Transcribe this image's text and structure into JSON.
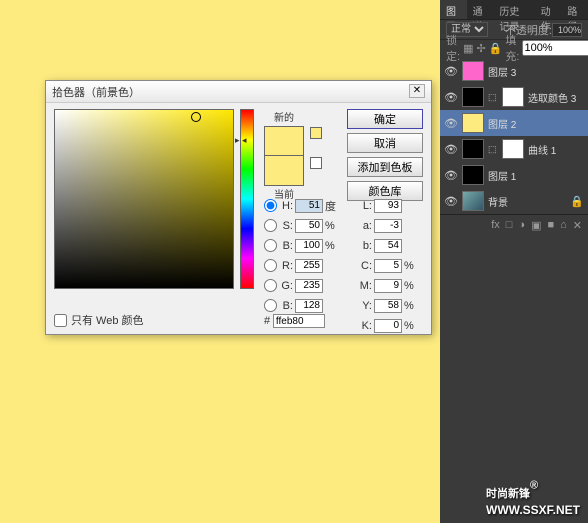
{
  "canvas": {
    "bg": "#fdeb80"
  },
  "dialog": {
    "title": "拾色器（前景色）",
    "close": "✕",
    "new_label": "新的",
    "current_label": "当前",
    "buttons": {
      "ok": "确定",
      "cancel": "取消",
      "add": "添加到色板",
      "lib": "颜色库"
    },
    "hsb": {
      "h": {
        "lbl": "H:",
        "val": "51",
        "unit": "度"
      },
      "s": {
        "lbl": "S:",
        "val": "50",
        "unit": "%"
      },
      "b": {
        "lbl": "B:",
        "val": "100",
        "unit": "%"
      }
    },
    "rgb": {
      "r": {
        "lbl": "R:",
        "val": "255"
      },
      "g": {
        "lbl": "G:",
        "val": "235"
      },
      "b": {
        "lbl": "B:",
        "val": "128"
      }
    },
    "lab": {
      "l": {
        "lbl": "L:",
        "val": "93"
      },
      "a": {
        "lbl": "a:",
        "val": "-3"
      },
      "b": {
        "lbl": "b:",
        "val": "54"
      }
    },
    "cmyk": {
      "c": {
        "lbl": "C:",
        "val": "5",
        "unit": "%"
      },
      "m": {
        "lbl": "M:",
        "val": "9",
        "unit": "%"
      },
      "y": {
        "lbl": "Y:",
        "val": "58",
        "unit": "%"
      },
      "k": {
        "lbl": "K:",
        "val": "0",
        "unit": "%"
      }
    },
    "webonly": "只有 Web 颜色",
    "hex": {
      "prefix": "#",
      "val": "ffeb80"
    }
  },
  "panel": {
    "tabs": [
      "图层",
      "通道",
      "历史记录",
      "动作",
      "路径"
    ],
    "blend": "正常",
    "opacity_lbl": "不透明度:",
    "opacity": "100%",
    "lock_lbl": "锁定:",
    "fill_lbl": "填充:",
    "fill": "100%",
    "layers": [
      {
        "name": "图层 3",
        "thumbClass": "pink"
      },
      {
        "name": "选取颜色 3",
        "thumbClass": "black",
        "hasMask": true
      },
      {
        "name": "图层 2",
        "thumbClass": "yellow",
        "sel": true
      },
      {
        "name": "曲线 1",
        "thumbClass": "black",
        "hasMask": true
      },
      {
        "name": "图层 1",
        "thumbClass": "black"
      },
      {
        "name": "背景",
        "thumbClass": "grad",
        "locked": true
      }
    ],
    "btm_icons": [
      "fx",
      "□",
      "◑",
      "▣",
      "■",
      "⌂",
      "✕"
    ]
  },
  "watermark": {
    "text": "时尚新锋",
    "url": "WWW.SSXF.NET",
    "reg": "®"
  }
}
